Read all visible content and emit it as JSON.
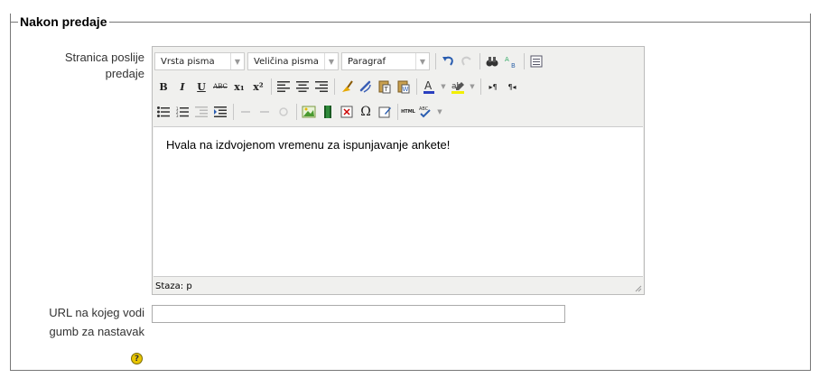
{
  "section": {
    "legend": "Nakon predaje"
  },
  "submit_page": {
    "label": "Stranica poslije predaje",
    "label_line1": "Stranica poslije",
    "label_line2": "predaje",
    "editor": {
      "font_family_select": "Vrsta pisma",
      "font_size_select": "Veličina pisma",
      "format_select": "Paragraf",
      "content_text": "Hvala na izdvojenom vremenu za ispunjavanje ankete!",
      "path_label": "Staza: p",
      "bold_glyph": "B",
      "italic_glyph": "I",
      "underline_glyph": "U",
      "strike_glyph": "ABC",
      "subscript_glyph": "x₁",
      "superscript_glyph": "x²",
      "omega_glyph": "Ω",
      "html_glyph": "HTML",
      "ltr_glyph": "▸¶",
      "rtl_glyph": "¶◂"
    }
  },
  "continue_url": {
    "label_line1": "URL na kojeg vodi",
    "label_line2": "gumb za nastavak",
    "value": "",
    "help_glyph": "?"
  }
}
